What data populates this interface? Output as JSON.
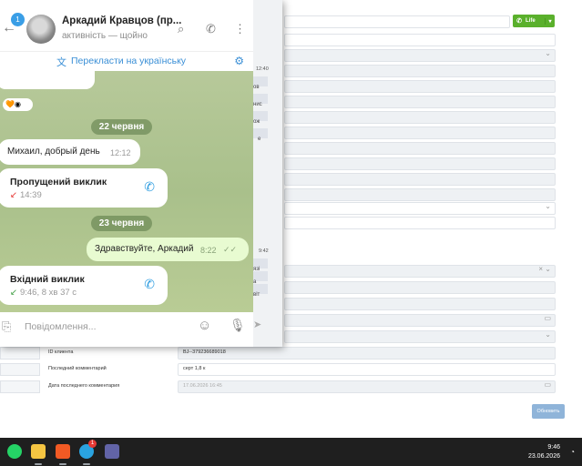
{
  "telegram": {
    "chat_name": "Аркадий Кравцов (пр...",
    "status": "активність — щойно",
    "unread_count": "1",
    "translate_label": "Перекласти на українську",
    "messages": {
      "date1": "22 червня",
      "msg1_text": "Михаил, добрый день",
      "msg1_time": "12:12",
      "missed_title": "Пропущений виклик",
      "missed_time": "14:39",
      "date2": "23 червня",
      "out_text": "Здравствуйте, Аркадий",
      "out_time": "8:22",
      "incoming_title": "Вхідний виклик",
      "incoming_meta": "9:46, 8 хв 37 с"
    },
    "composer_placeholder": "Повідомлення..."
  },
  "crm": {
    "life_button": "Life",
    "labels": {
      "client_id": "ID клиента",
      "last_comment": "Последний комментарий",
      "last_comment_date": "Дата последнего комментария"
    },
    "values": {
      "client_id": "BJ--379236689018",
      "last_comment": "серт 1,8 к",
      "last_comment_date": "17.06.2026 16:45"
    },
    "save_button": "Обновить",
    "peek_time_1": "12:40",
    "peek_time_2": "9:42",
    "peek_texts": [
      "ов",
      "нис",
      "ож",
      "е",
      "язі",
      "а",
      "віт"
    ]
  },
  "taskbar": {
    "time": "9:46",
    "date": "23.06.2026",
    "telegram_badge": "1"
  },
  "colors": {
    "accent": "#3a8fd6",
    "life_green": "#5ab02c",
    "chat_bg": "#b7c99a",
    "outgoing_bubble": "#e8fbd1"
  }
}
